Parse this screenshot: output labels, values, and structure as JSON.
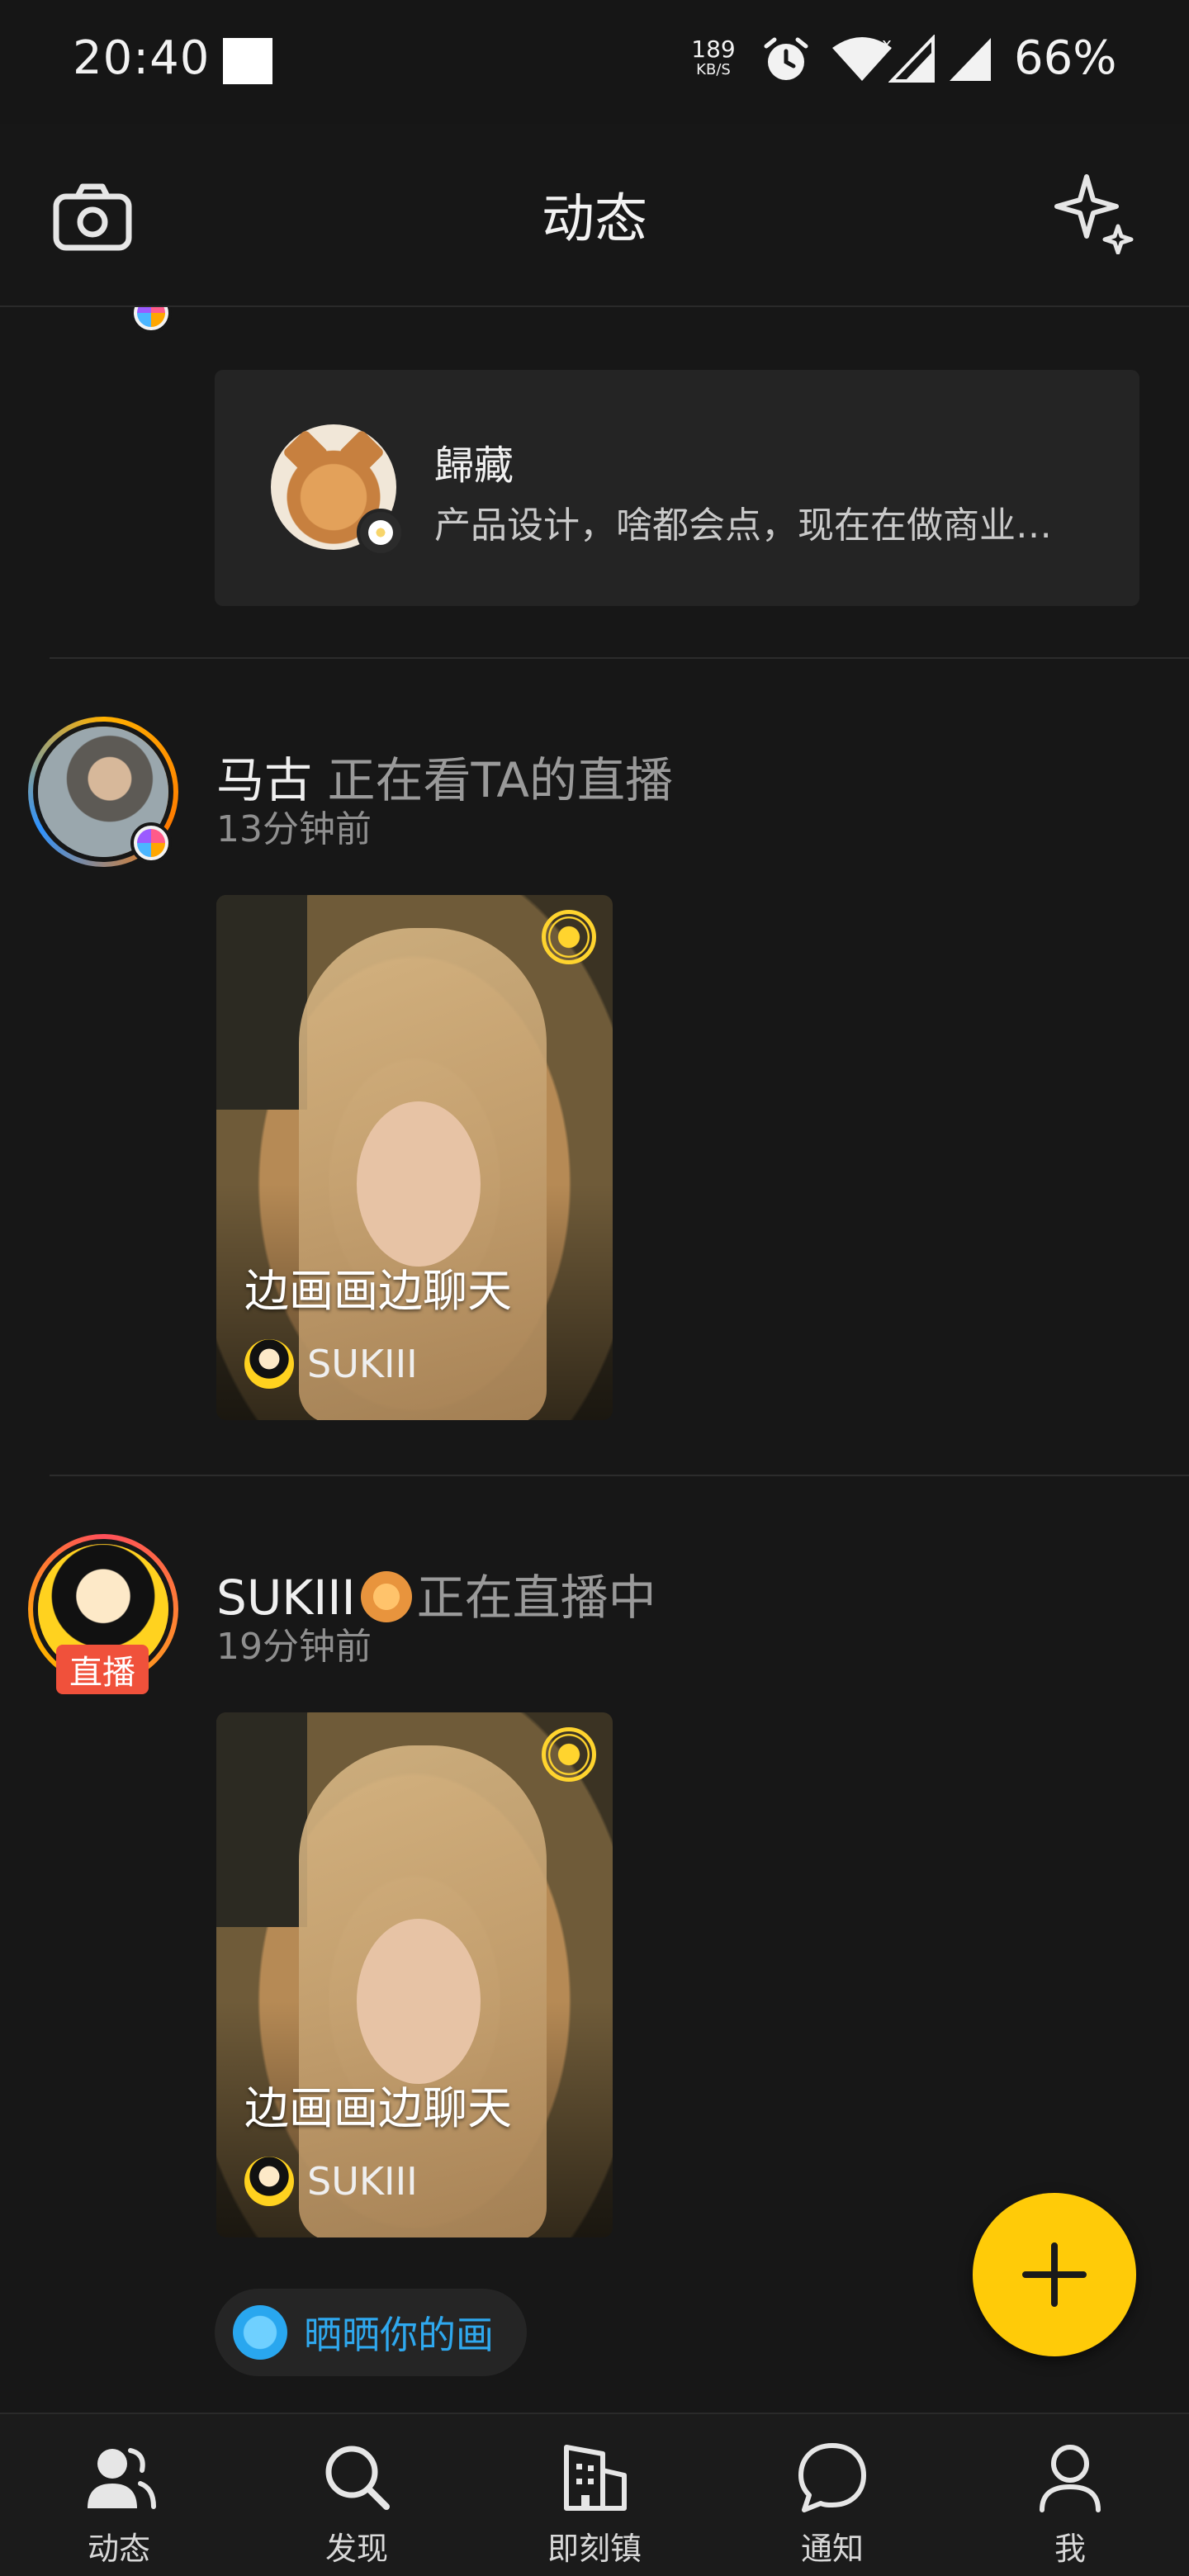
{
  "status_bar": {
    "time": "20:40",
    "net_speed_value": "189",
    "net_speed_unit": "KB/S",
    "battery": "66%"
  },
  "header": {
    "title": "动态",
    "left_icon": "camera-icon",
    "right_icon": "sparkle-icon"
  },
  "feed": {
    "shared_profile": {
      "name": "歸藏",
      "bio": "产品设计，啥都会点，现在在做商业…"
    },
    "posts": [
      {
        "user": "马古",
        "action": "正在看TA的直播",
        "time": "13分钟前",
        "live": {
          "title": "边画画边聊天",
          "host": "SUKIII"
        }
      },
      {
        "user": "SUKIII",
        "action": "正在直播中",
        "time": "19分钟前",
        "badge_label": "直播",
        "live": {
          "title": "边画画边聊天",
          "host": "SUKIII"
        },
        "tag": "晒晒你的画"
      }
    ]
  },
  "fab": {
    "icon": "plus-icon"
  },
  "tabs": [
    {
      "label": "动态",
      "icon": "users-icon"
    },
    {
      "label": "发现",
      "icon": "search-icon"
    },
    {
      "label": "即刻镇",
      "icon": "building-icon"
    },
    {
      "label": "通知",
      "icon": "chat-bubble-icon"
    },
    {
      "label": "我",
      "icon": "profile-icon"
    }
  ],
  "colors": {
    "background": "#171717",
    "accent": "#ffcb08",
    "live_red": "#f0513b",
    "tag_blue": "#2fa8ee"
  }
}
